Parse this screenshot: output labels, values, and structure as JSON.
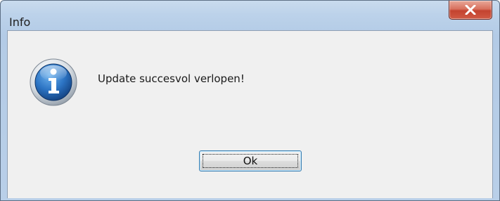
{
  "window": {
    "title": "Info"
  },
  "dialog": {
    "message": "Update succesvol verlopen!",
    "icon": "info-icon",
    "ok_label": "Ok"
  },
  "colors": {
    "titlebar": "#bcd2ea",
    "close_button": "#c4432f",
    "client_background": "#f0f0f0",
    "button_focus_border": "#3c7fb1"
  }
}
